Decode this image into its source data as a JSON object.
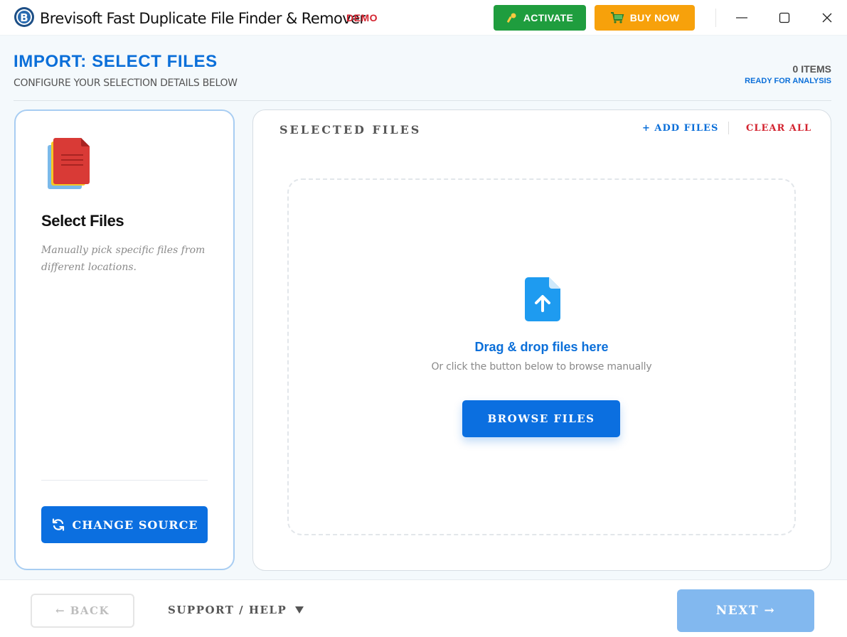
{
  "window": {
    "title": "Brevisoft Fast Duplicate File Finder & Remover",
    "demo_badge": "DEMO",
    "activate_label": "ACTIVATE",
    "buy_now_label": "BUY NOW"
  },
  "header": {
    "title": "IMPORT: SELECT FILES",
    "subtitle": "CONFIGURE YOUR SELECTION DETAILS BELOW",
    "items_count": "0 ITEMS",
    "items_status": "READY FOR ANALYSIS"
  },
  "source_card": {
    "title": "Select Files",
    "description": "Manually pick specific files from different locations.",
    "change_source_label": "CHANGE SOURCE"
  },
  "files_panel": {
    "label": "SELECTED FILES",
    "add_files_label": "+ ADD FILES",
    "clear_all_label": "CLEAR ALL",
    "drop_title": "Drag & drop files here",
    "drop_hint": "Or click the button below to browse manually",
    "browse_label": "BROWSE FILES"
  },
  "footer": {
    "back_label": "← BACK",
    "support_label": "SUPPORT / HELP",
    "next_label": "NEXT →"
  },
  "colors": {
    "accent": "#0b6fe0",
    "activate": "#1f9d3e",
    "buy_now": "#f7a10b",
    "danger": "#d3232f",
    "next_disabled": "#82b8ef"
  }
}
